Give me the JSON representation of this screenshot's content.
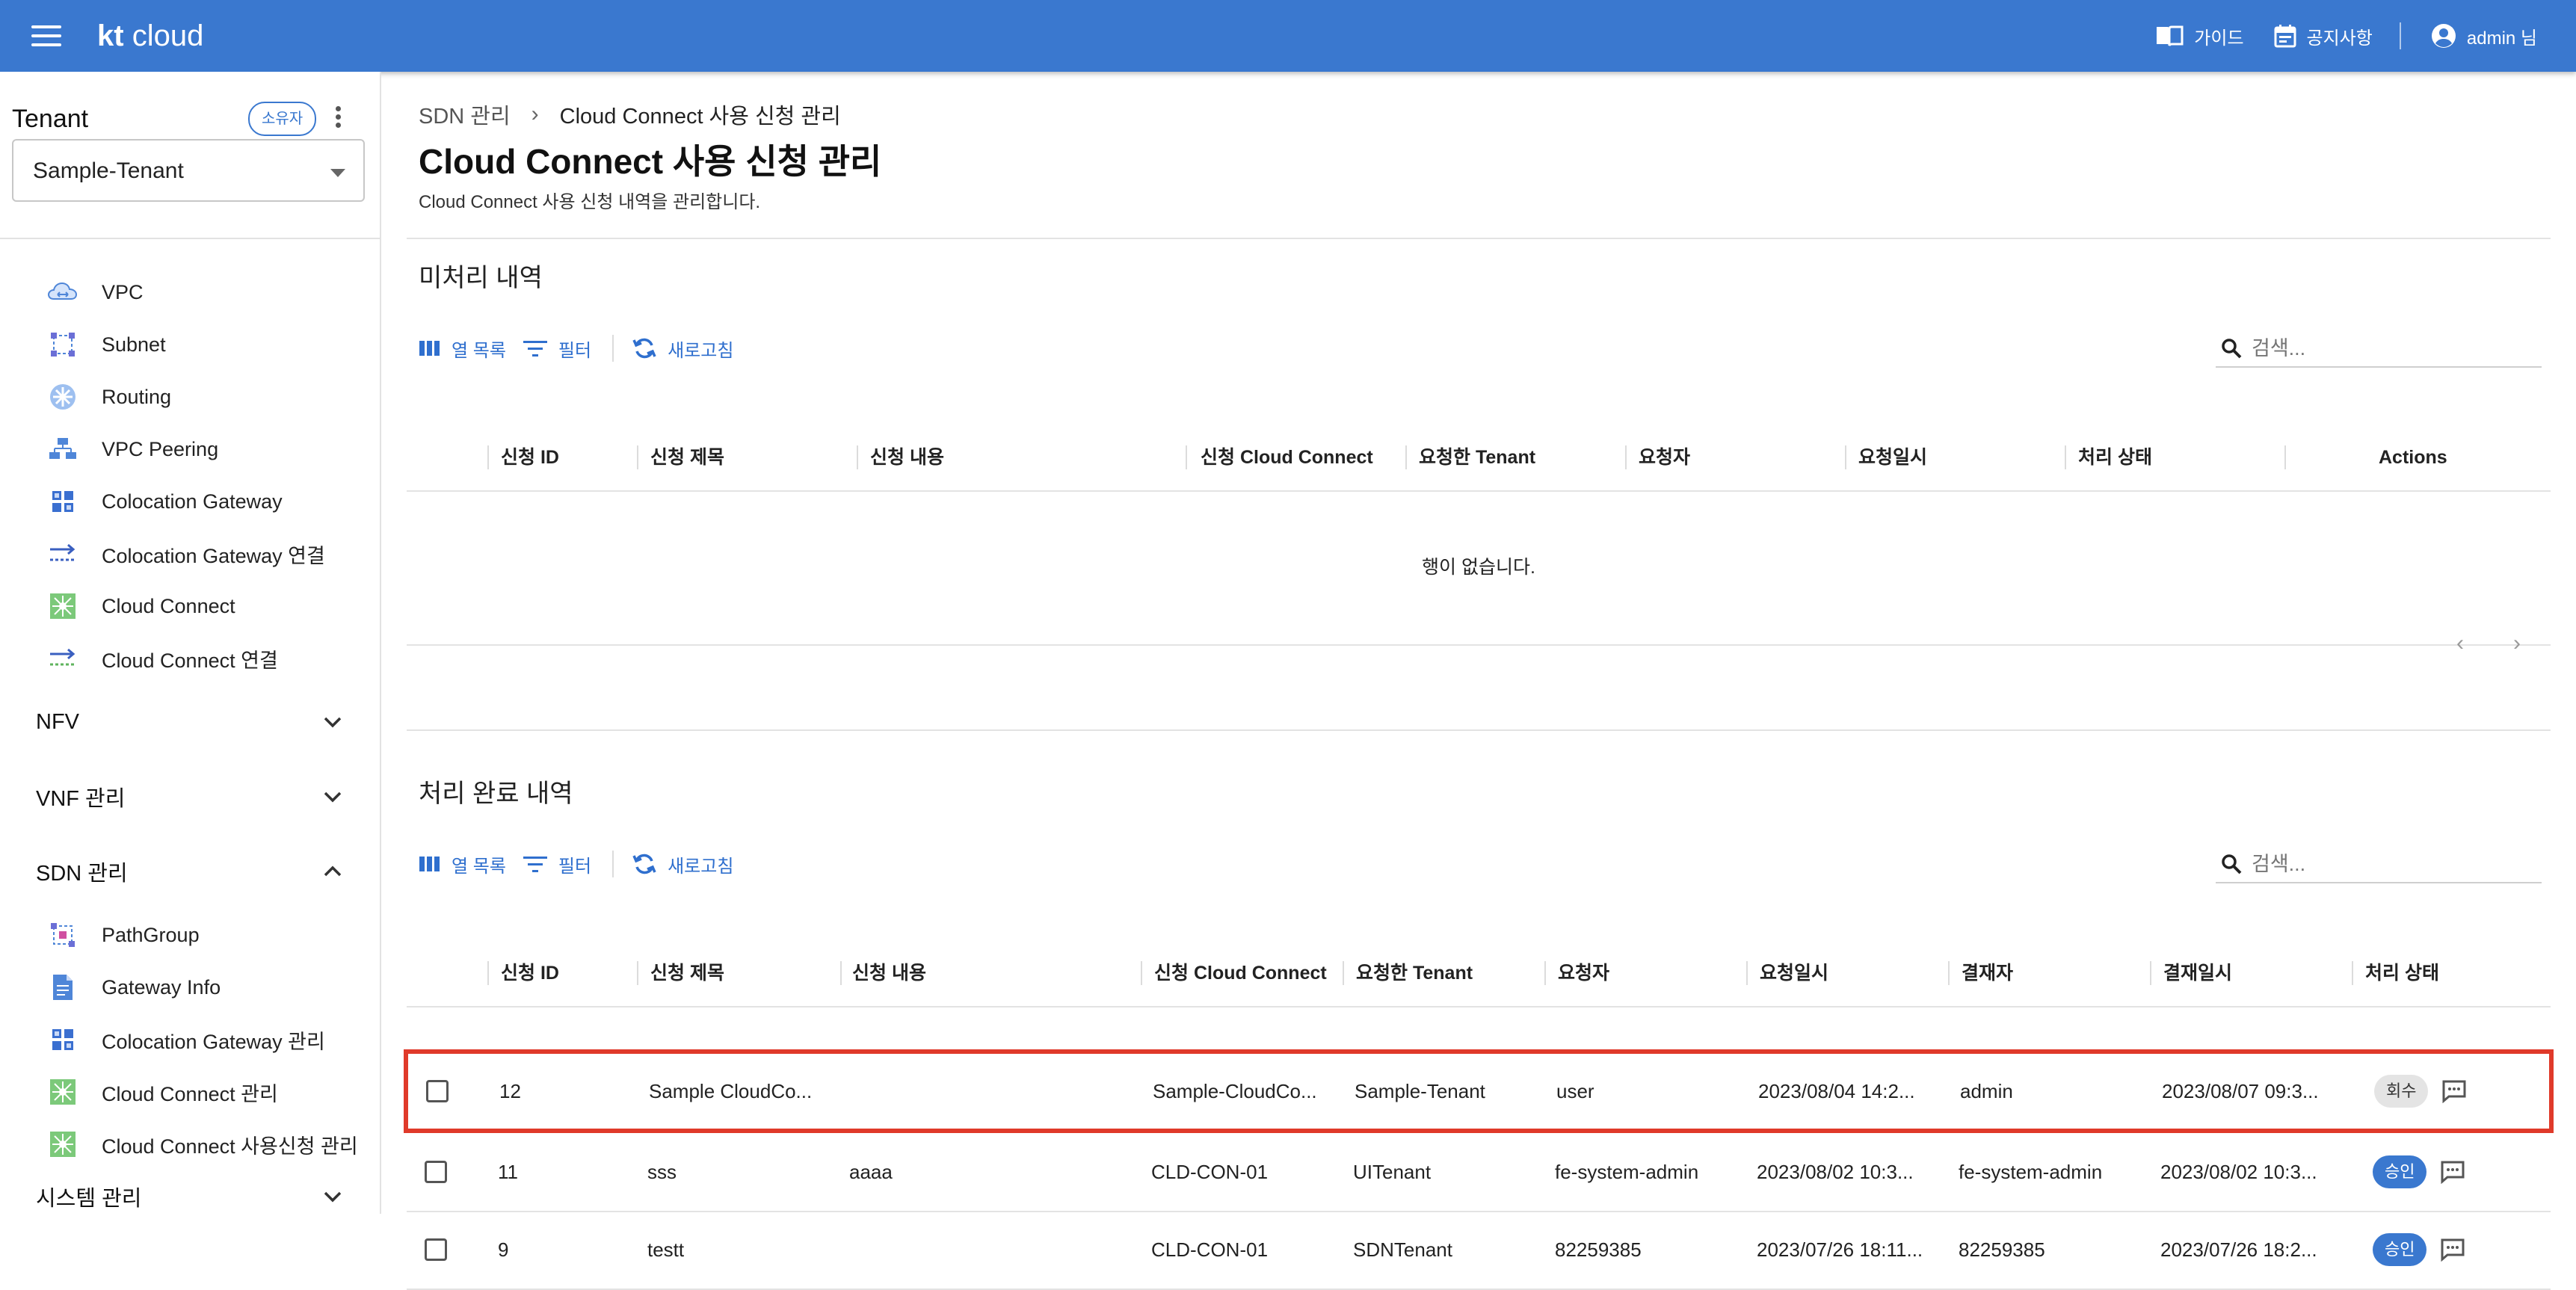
{
  "topbar": {
    "logo_kt": "kt",
    "logo_cloud": "cloud",
    "guide": "가이드",
    "notice": "공지사항",
    "user": "admin 님"
  },
  "sidebar": {
    "tenant_title": "Tenant",
    "owner_badge": "소유자",
    "tenant_value": "Sample-Tenant",
    "items_top": [
      {
        "label": "VPC",
        "icon": "vpc-icon"
      },
      {
        "label": "Subnet",
        "icon": "subnet-icon"
      },
      {
        "label": "Routing",
        "icon": "routing-icon"
      },
      {
        "label": "VPC Peering",
        "icon": "vpc-peering-icon"
      },
      {
        "label": "Colocation Gateway",
        "icon": "colocation-gateway-icon"
      },
      {
        "label": "Colocation Gateway 연결",
        "icon": "connection-arrow-icon"
      },
      {
        "label": "Cloud Connect",
        "icon": "cloud-connect-icon"
      },
      {
        "label": "Cloud Connect 연결",
        "icon": "connection-arrow-icon"
      }
    ],
    "groups": [
      {
        "label": "NFV",
        "expanded": false
      },
      {
        "label": "VNF 관리",
        "expanded": false
      },
      {
        "label": "SDN 관리",
        "expanded": true
      }
    ],
    "items_sdn": [
      {
        "label": "PathGroup",
        "icon": "pathgroup-icon"
      },
      {
        "label": "Gateway Info",
        "icon": "document-icon"
      },
      {
        "label": "Colocation Gateway 관리",
        "icon": "colocation-gateway-icon"
      },
      {
        "label": "Cloud Connect 관리",
        "icon": "cloud-connect-icon"
      },
      {
        "label": "Cloud Connect 사용신청 관리",
        "icon": "cloud-connect-icon"
      }
    ],
    "group_system": "시스템 관리"
  },
  "main": {
    "breadcrumb_parent": "SDN 관리",
    "breadcrumb_current": "Cloud Connect 사용 신청 관리",
    "title": "Cloud Connect 사용 신청 관리",
    "subtitle": "Cloud Connect 사용 신청 내역을 관리합니다.",
    "toolbar": {
      "columns": "열 목록",
      "filter": "필터",
      "refresh": "새로고침"
    },
    "search_placeholder": "검색...",
    "pending": {
      "title": "미처리 내역",
      "columns": [
        "신청 ID",
        "신청 제목",
        "신청 내용",
        "신청 Cloud Connect",
        "요청한 Tenant",
        "요청자",
        "요청일시",
        "처리 상태",
        "Actions"
      ],
      "empty_text": "행이 없습니다."
    },
    "done": {
      "title": "처리 완료 내역",
      "columns": [
        "신청 ID",
        "신청 제목",
        "신청 내용",
        "신청 Cloud Connect",
        "요청한 Tenant",
        "요청자",
        "요청일시",
        "결재자",
        "결재일시",
        "처리 상태"
      ],
      "rows": [
        {
          "id": "12",
          "title": "Sample CloudCo...",
          "content": "",
          "cc": "Sample-CloudCo...",
          "tenant": "Sample-Tenant",
          "requester": "user",
          "req_date": "2023/08/04 14:2...",
          "approver": "admin",
          "appr_date": "2023/08/07 09:3...",
          "status": "회수",
          "status_kind": "grey",
          "highlighted": true
        },
        {
          "id": "11",
          "title": "sss",
          "content": "aaaa",
          "cc": "CLD-CON-01",
          "tenant": "UITenant",
          "requester": "fe-system-admin",
          "req_date": "2023/08/02 10:3...",
          "approver": "fe-system-admin",
          "appr_date": "2023/08/02 10:3...",
          "status": "승인",
          "status_kind": "blue",
          "highlighted": false
        },
        {
          "id": "9",
          "title": "testt",
          "content": "",
          "cc": "CLD-CON-01",
          "tenant": "SDNTenant",
          "requester": "82259385",
          "req_date": "2023/07/26 18:11...",
          "approver": "82259385",
          "appr_date": "2023/07/26 18:2...",
          "status": "승인",
          "status_kind": "blue",
          "highlighted": false
        }
      ]
    }
  },
  "colors": {
    "primary": "#3a78cf",
    "highlight": "#e03a2a"
  }
}
